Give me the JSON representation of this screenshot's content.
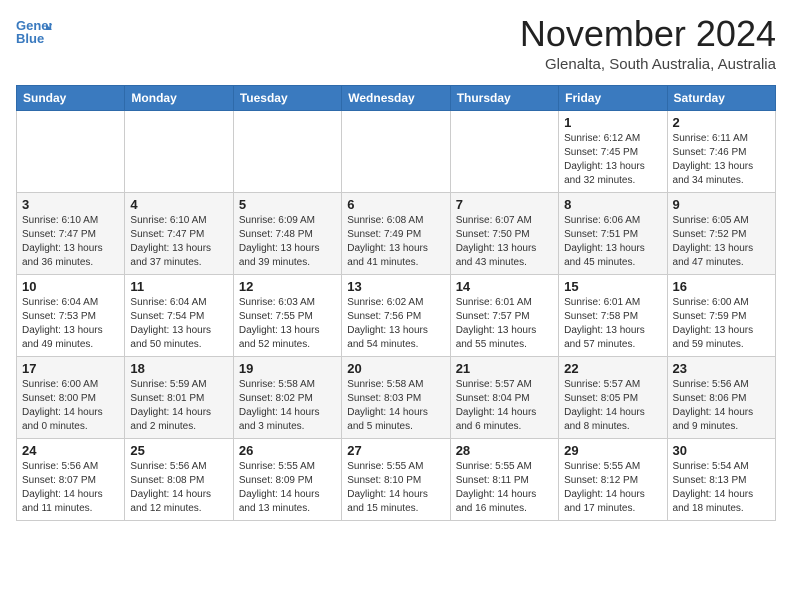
{
  "header": {
    "logo_line1": "General",
    "logo_line2": "Blue",
    "month": "November 2024",
    "location": "Glenalta, South Australia, Australia"
  },
  "weekdays": [
    "Sunday",
    "Monday",
    "Tuesday",
    "Wednesday",
    "Thursday",
    "Friday",
    "Saturday"
  ],
  "weeks": [
    [
      {
        "day": "",
        "info": ""
      },
      {
        "day": "",
        "info": ""
      },
      {
        "day": "",
        "info": ""
      },
      {
        "day": "",
        "info": ""
      },
      {
        "day": "",
        "info": ""
      },
      {
        "day": "1",
        "info": "Sunrise: 6:12 AM\nSunset: 7:45 PM\nDaylight: 13 hours\nand 32 minutes."
      },
      {
        "day": "2",
        "info": "Sunrise: 6:11 AM\nSunset: 7:46 PM\nDaylight: 13 hours\nand 34 minutes."
      }
    ],
    [
      {
        "day": "3",
        "info": "Sunrise: 6:10 AM\nSunset: 7:47 PM\nDaylight: 13 hours\nand 36 minutes."
      },
      {
        "day": "4",
        "info": "Sunrise: 6:10 AM\nSunset: 7:47 PM\nDaylight: 13 hours\nand 37 minutes."
      },
      {
        "day": "5",
        "info": "Sunrise: 6:09 AM\nSunset: 7:48 PM\nDaylight: 13 hours\nand 39 minutes."
      },
      {
        "day": "6",
        "info": "Sunrise: 6:08 AM\nSunset: 7:49 PM\nDaylight: 13 hours\nand 41 minutes."
      },
      {
        "day": "7",
        "info": "Sunrise: 6:07 AM\nSunset: 7:50 PM\nDaylight: 13 hours\nand 43 minutes."
      },
      {
        "day": "8",
        "info": "Sunrise: 6:06 AM\nSunset: 7:51 PM\nDaylight: 13 hours\nand 45 minutes."
      },
      {
        "day": "9",
        "info": "Sunrise: 6:05 AM\nSunset: 7:52 PM\nDaylight: 13 hours\nand 47 minutes."
      }
    ],
    [
      {
        "day": "10",
        "info": "Sunrise: 6:04 AM\nSunset: 7:53 PM\nDaylight: 13 hours\nand 49 minutes."
      },
      {
        "day": "11",
        "info": "Sunrise: 6:04 AM\nSunset: 7:54 PM\nDaylight: 13 hours\nand 50 minutes."
      },
      {
        "day": "12",
        "info": "Sunrise: 6:03 AM\nSunset: 7:55 PM\nDaylight: 13 hours\nand 52 minutes."
      },
      {
        "day": "13",
        "info": "Sunrise: 6:02 AM\nSunset: 7:56 PM\nDaylight: 13 hours\nand 54 minutes."
      },
      {
        "day": "14",
        "info": "Sunrise: 6:01 AM\nSunset: 7:57 PM\nDaylight: 13 hours\nand 55 minutes."
      },
      {
        "day": "15",
        "info": "Sunrise: 6:01 AM\nSunset: 7:58 PM\nDaylight: 13 hours\nand 57 minutes."
      },
      {
        "day": "16",
        "info": "Sunrise: 6:00 AM\nSunset: 7:59 PM\nDaylight: 13 hours\nand 59 minutes."
      }
    ],
    [
      {
        "day": "17",
        "info": "Sunrise: 6:00 AM\nSunset: 8:00 PM\nDaylight: 14 hours\nand 0 minutes."
      },
      {
        "day": "18",
        "info": "Sunrise: 5:59 AM\nSunset: 8:01 PM\nDaylight: 14 hours\nand 2 minutes."
      },
      {
        "day": "19",
        "info": "Sunrise: 5:58 AM\nSunset: 8:02 PM\nDaylight: 14 hours\nand 3 minutes."
      },
      {
        "day": "20",
        "info": "Sunrise: 5:58 AM\nSunset: 8:03 PM\nDaylight: 14 hours\nand 5 minutes."
      },
      {
        "day": "21",
        "info": "Sunrise: 5:57 AM\nSunset: 8:04 PM\nDaylight: 14 hours\nand 6 minutes."
      },
      {
        "day": "22",
        "info": "Sunrise: 5:57 AM\nSunset: 8:05 PM\nDaylight: 14 hours\nand 8 minutes."
      },
      {
        "day": "23",
        "info": "Sunrise: 5:56 AM\nSunset: 8:06 PM\nDaylight: 14 hours\nand 9 minutes."
      }
    ],
    [
      {
        "day": "24",
        "info": "Sunrise: 5:56 AM\nSunset: 8:07 PM\nDaylight: 14 hours\nand 11 minutes."
      },
      {
        "day": "25",
        "info": "Sunrise: 5:56 AM\nSunset: 8:08 PM\nDaylight: 14 hours\nand 12 minutes."
      },
      {
        "day": "26",
        "info": "Sunrise: 5:55 AM\nSunset: 8:09 PM\nDaylight: 14 hours\nand 13 minutes."
      },
      {
        "day": "27",
        "info": "Sunrise: 5:55 AM\nSunset: 8:10 PM\nDaylight: 14 hours\nand 15 minutes."
      },
      {
        "day": "28",
        "info": "Sunrise: 5:55 AM\nSunset: 8:11 PM\nDaylight: 14 hours\nand 16 minutes."
      },
      {
        "day": "29",
        "info": "Sunrise: 5:55 AM\nSunset: 8:12 PM\nDaylight: 14 hours\nand 17 minutes."
      },
      {
        "day": "30",
        "info": "Sunrise: 5:54 AM\nSunset: 8:13 PM\nDaylight: 14 hours\nand 18 minutes."
      }
    ]
  ]
}
